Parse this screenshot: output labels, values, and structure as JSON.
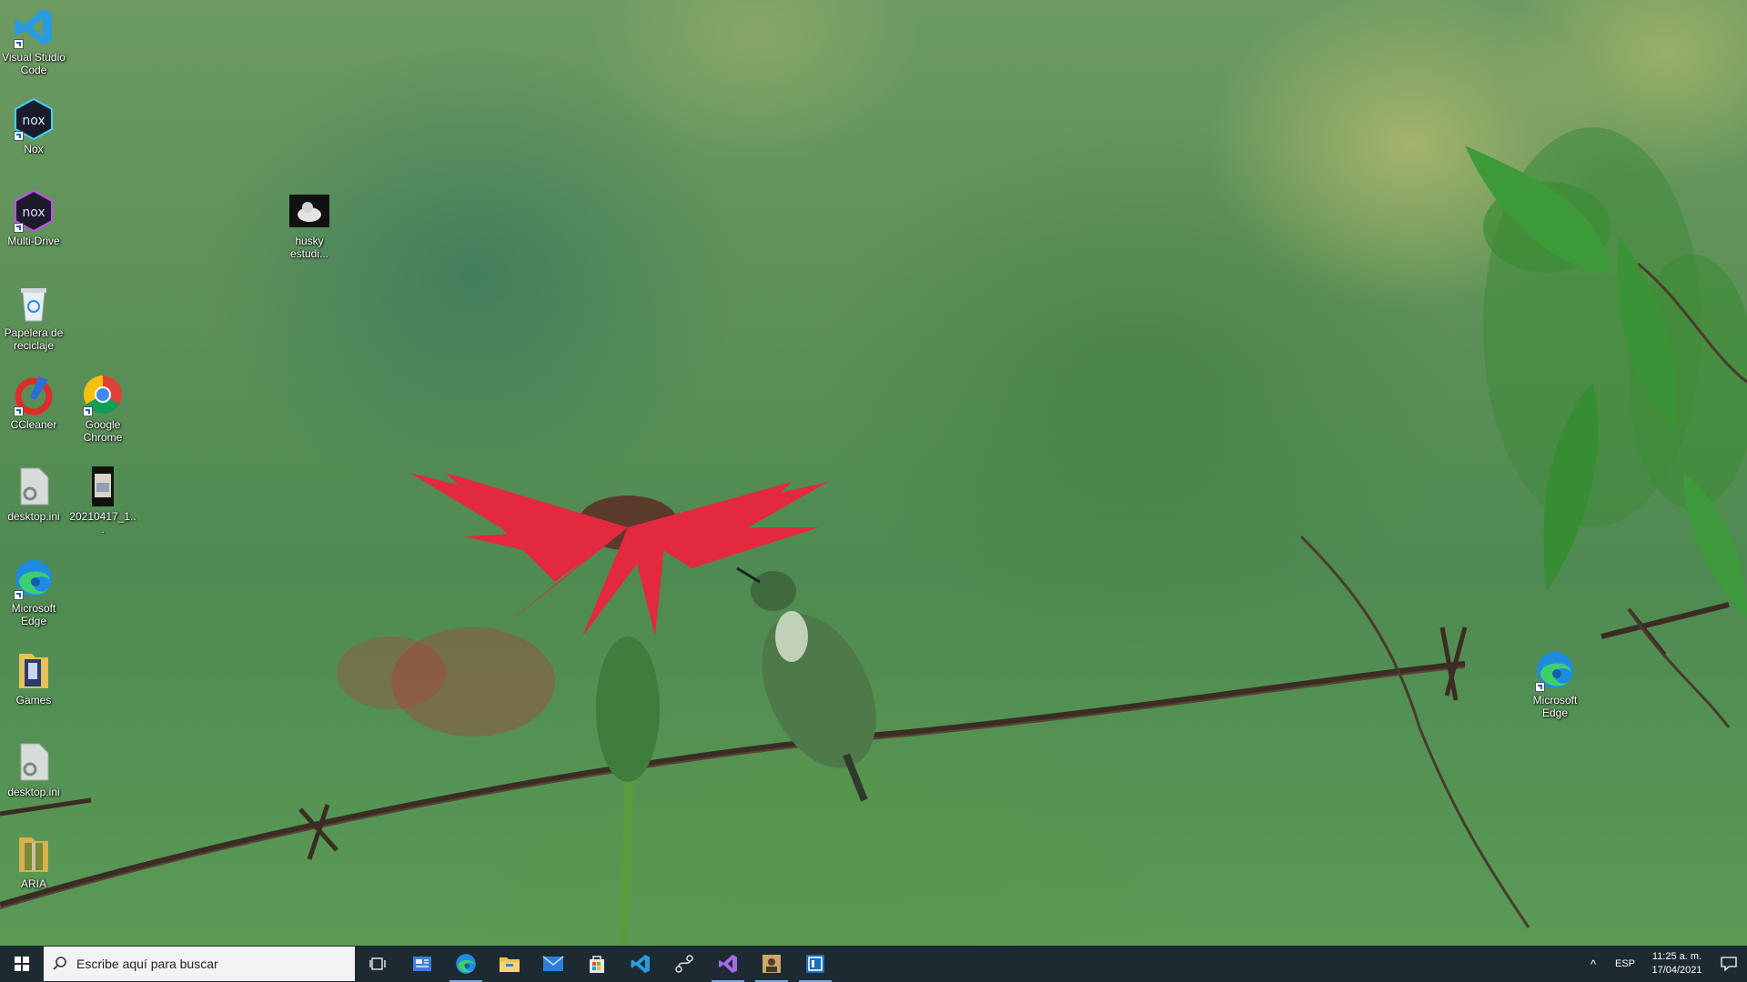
{
  "desktop": {
    "icons": [
      {
        "label": "Visual Studio Code",
        "icon": "vscode-icon"
      },
      {
        "label": "Nox",
        "icon": "nox-icon"
      },
      {
        "label": "Multi-Drive",
        "icon": "nox-multidrive-icon"
      },
      {
        "label": "Papelera de reciclaje",
        "icon": "recycle-bin-icon"
      },
      {
        "label": "CCleaner",
        "icon": "ccleaner-icon"
      },
      {
        "label": "Google Chrome",
        "icon": "chrome-icon"
      },
      {
        "label": "desktop.ini",
        "icon": "config-file-icon"
      },
      {
        "label": "20210417_1...",
        "icon": "video-file-icon"
      },
      {
        "label": "Microsoft Edge",
        "icon": "edge-icon"
      },
      {
        "label": "Games",
        "icon": "folder-icon"
      },
      {
        "label": "desktop.ini",
        "icon": "config-file-icon"
      },
      {
        "label": "ARIA",
        "icon": "zip-folder-icon"
      },
      {
        "label": "husky estudi...",
        "icon": "husky-image-icon"
      },
      {
        "label": "Microsoft Edge",
        "icon": "edge-icon"
      }
    ]
  },
  "taskbar": {
    "search_placeholder": "Escribe aquí para buscar",
    "apps": [
      "task-view-icon",
      "news-weather-icon",
      "edge-icon",
      "file-explorer-icon",
      "mail-icon",
      "microsoft-store-icon",
      "vscode-icon",
      "git-icon",
      "visual-studio-icon",
      "photo-app-icon",
      "app-window-icon"
    ],
    "tray": {
      "language": "ESP",
      "time": "11:25 a. m.",
      "date": "17/04/2021"
    }
  },
  "colors": {
    "taskbar_bg": "#1e2a32",
    "accent": "#79a8e6"
  }
}
